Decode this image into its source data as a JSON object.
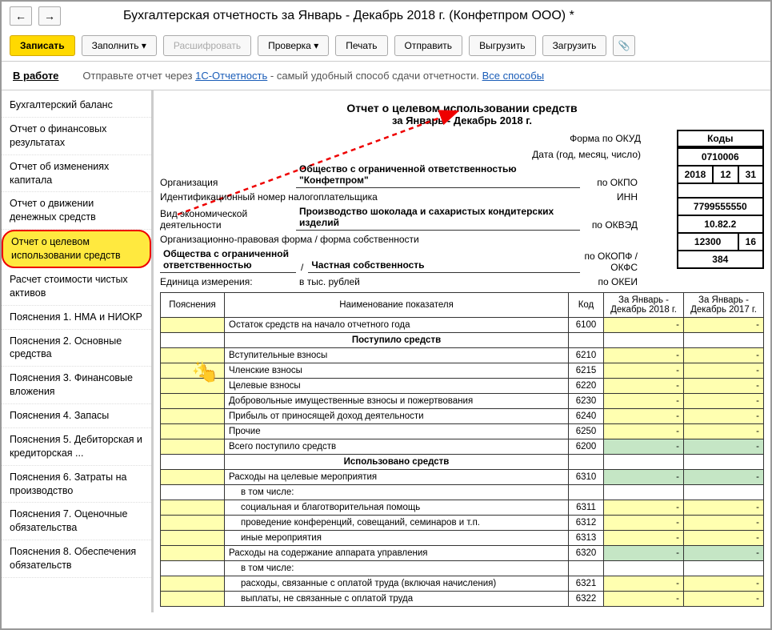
{
  "header": {
    "back": "←",
    "forward": "→",
    "title": "Бухгалтерская отчетность за Январь - Декабрь 2018 г. (Конфетпром ООО) *"
  },
  "toolbar": {
    "save": "Записать",
    "fill": "Заполнить",
    "decode": "Расшифровать",
    "check": "Проверка",
    "print": "Печать",
    "send": "Отправить",
    "export": "Выгрузить",
    "import": "Загрузить",
    "attach": "📎"
  },
  "status": {
    "state": "В работе",
    "hint_prefix": "Отправьте отчет через ",
    "hint_link": "1С-Отчетность",
    "hint_suffix": " - самый удобный способ сдачи отчетности. ",
    "hint_all": "Все способы"
  },
  "sidebar": {
    "items": [
      "Бухгалтерский баланс",
      "Отчет о финансовых результатах",
      "Отчет об изменениях капитала",
      "Отчет о движении денежных средств",
      "Отчет о целевом использовании средств",
      "Расчет стоимости чистых активов",
      "Пояснения 1. НМА и НИОКР",
      "Пояснения 2. Основные средства",
      "Пояснения 3. Финансовые вложения",
      "Пояснения 4. Запасы",
      "Пояснения 5. Дебиторская и кредиторская ...",
      "Пояснения 6. Затраты на производство",
      "Пояснения 7. Оценочные обязательства",
      "Пояснения 8. Обеспечения обязательств"
    ],
    "active": 4
  },
  "report": {
    "title": "Отчет о целевом использовании средств",
    "period": "за Январь - Декабрь 2018 г.",
    "codes_label": "Коды",
    "okud_label": "Форма по ОКУД",
    "okud": "0710006",
    "date_label": "Дата (год, месяц, число)",
    "date_y": "2018",
    "date_m": "12",
    "date_d": "31",
    "org_label": "Организация",
    "org": "Общество с ограниченной ответственностью \"Конфетпром\"",
    "okpo_label": "по ОКПО",
    "okpo": "",
    "inn_label_full": "Идентификационный номер налогоплательщика",
    "inn_label": "ИНН",
    "inn": "7799555550",
    "activity_label": "Вид экономической деятельности",
    "activity": "Производство шоколада и сахаристых кондитерских изделий",
    "okved_label": "по ОКВЭД",
    "okved": "10.82.2",
    "form_label": "Организационно-правовая форма / форма собственности",
    "form1": "Общества с ограниченной ответственностью",
    "form2": "Частная собственность",
    "okopf_label": "по ОКОПФ / ОКФС",
    "okopf": "12300",
    "okfs": "16",
    "unit_label": "Единица измерения:",
    "unit": "в тыс. рублей",
    "okei_label": "по ОКЕИ",
    "okei": "384"
  },
  "table": {
    "headers": {
      "expl": "Пояснения",
      "name": "Наименование показателя",
      "code": "Код",
      "curr": "За Январь - Декабрь 2018 г.",
      "prev": "За Январь - Декабрь 2017 г."
    },
    "rows": [
      {
        "name": "Остаток средств на начало отчетного года",
        "code": "6100",
        "yellow_expl": true,
        "val_curr": "-",
        "val_prev": "-",
        "c_yellow": true,
        "p_yellow": true
      },
      {
        "name": "Поступило средств",
        "center": true,
        "no_code": true,
        "bold": true
      },
      {
        "name": "Вступительные взносы",
        "code": "6210",
        "yellow_expl": true,
        "val_curr": "-",
        "val_prev": "-",
        "c_yellow": true,
        "p_yellow": true
      },
      {
        "name": "Членские взносы",
        "code": "6215",
        "yellow_expl": true,
        "val_curr": "-",
        "val_prev": "-",
        "c_yellow": true,
        "p_yellow": true
      },
      {
        "name": "Целевые взносы",
        "code": "6220",
        "yellow_expl": true,
        "val_curr": "-",
        "val_prev": "-",
        "c_yellow": true,
        "p_yellow": true
      },
      {
        "name": "Добровольные имущественные взносы и пожертвования",
        "code": "6230",
        "yellow_expl": true,
        "val_curr": "-",
        "val_prev": "-",
        "c_yellow": true,
        "p_yellow": true
      },
      {
        "name": "Прибыль от приносящей доход деятельности",
        "code": "6240",
        "yellow_expl": true,
        "val_curr": "-",
        "val_prev": "-",
        "c_yellow": true,
        "p_yellow": true
      },
      {
        "name": "Прочие",
        "code": "6250",
        "yellow_expl": true,
        "val_curr": "-",
        "val_prev": "-",
        "c_yellow": true,
        "p_yellow": true
      },
      {
        "name": "Всего поступило средств",
        "code": "6200",
        "yellow_expl": true,
        "val_curr": "-",
        "val_prev": "-",
        "c_green": true,
        "p_green": true
      },
      {
        "name": "Использовано средств",
        "center": true,
        "no_code": true,
        "bold": true
      },
      {
        "name": "Расходы на целевые мероприятия",
        "code": "6310",
        "yellow_expl": true,
        "val_curr": "-",
        "val_prev": "-",
        "c_green": true,
        "p_green": true
      },
      {
        "name": "в том числе:",
        "indent": 1,
        "no_code": true
      },
      {
        "name": "социальная и благотворительная помощь",
        "code": "6311",
        "yellow_expl": true,
        "indent": 1,
        "val_curr": "-",
        "val_prev": "-",
        "c_yellow": true,
        "p_yellow": true
      },
      {
        "name": "проведение конференций, совещаний, семинаров и т.п.",
        "code": "6312",
        "yellow_expl": true,
        "indent": 1,
        "val_curr": "-",
        "val_prev": "-",
        "c_yellow": true,
        "p_yellow": true
      },
      {
        "name": "иные мероприятия",
        "code": "6313",
        "yellow_expl": true,
        "indent": 1,
        "val_curr": "-",
        "val_prev": "-",
        "c_yellow": true,
        "p_yellow": true
      },
      {
        "name": "Расходы на содержание аппарата управления",
        "code": "6320",
        "yellow_expl": true,
        "val_curr": "-",
        "val_prev": "-",
        "c_green": true,
        "p_green": true
      },
      {
        "name": "в том числе:",
        "indent": 1,
        "no_code": true
      },
      {
        "name": "расходы, связанные с оплатой труда (включая начисления)",
        "code": "6321",
        "yellow_expl": true,
        "indent": 1,
        "val_curr": "-",
        "val_prev": "-",
        "c_yellow": true,
        "p_yellow": true
      },
      {
        "name": "выплаты, не связанные с оплатой труда",
        "code": "6322",
        "yellow_expl": true,
        "indent": 1,
        "val_curr": "-",
        "val_prev": "-",
        "c_yellow": true,
        "p_yellow": true
      }
    ]
  }
}
